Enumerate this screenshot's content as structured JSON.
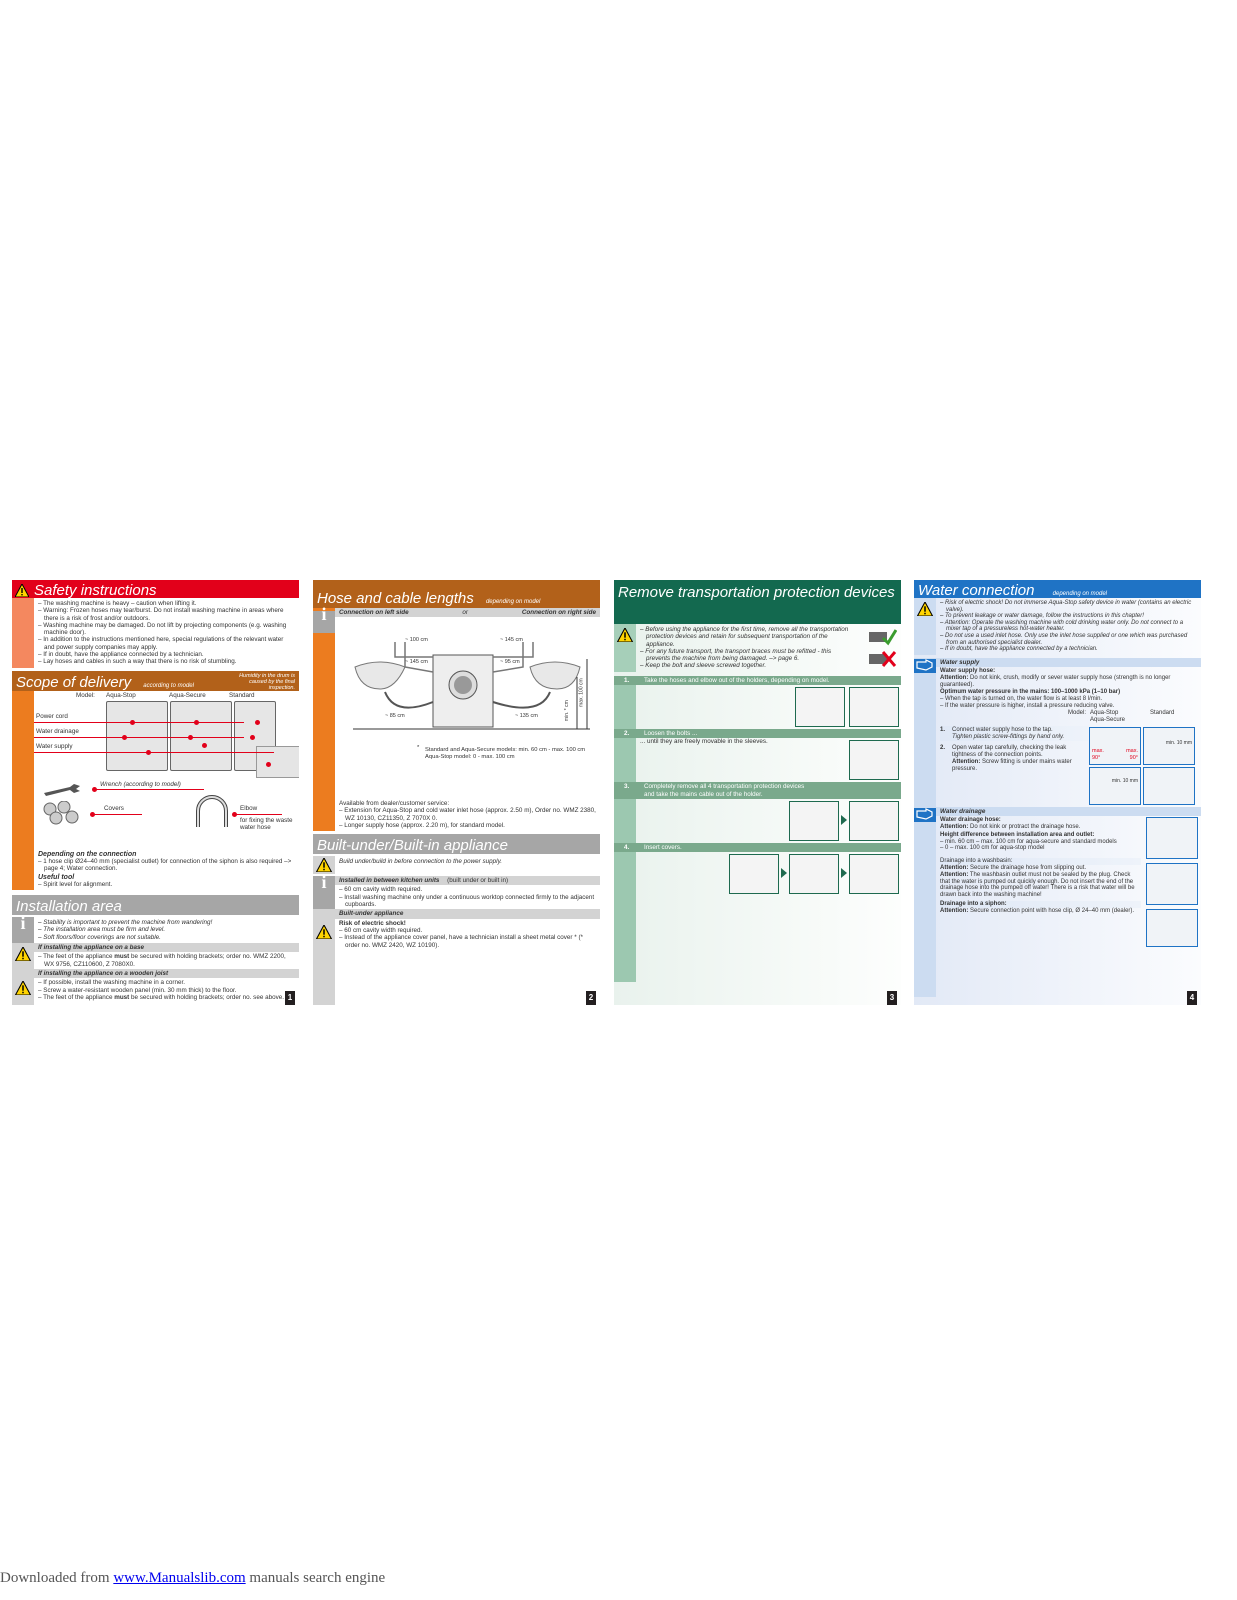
{
  "page1": {
    "safety": {
      "title": "Safety instructions",
      "items": [
        "The washing machine is heavy – caution when lifting it.",
        "Warning: Frozen hoses may tear/burst. Do not install washing machine in areas where there is a risk of frost and/or outdoors.",
        "Washing machine may be damaged. Do not lift by projecting components (e.g. washing machine door).",
        "In addition to the instructions mentioned here, special regulations of the relevant water and power supply companies may apply.",
        "If in doubt, have the appliance connected by a technician.",
        "Lay hoses and cables in such a way that there is no risk of stumbling."
      ]
    },
    "scope": {
      "title": "Scope of delivery",
      "subtitle": "according to model",
      "note": "Humidity in the drum is caused by the final inspection.",
      "model_label": "Model:",
      "models": [
        "Aqua-Stop",
        "Aqua-Secure",
        "Standard"
      ],
      "parts": [
        "Power cord",
        "Water drainage",
        "Water supply"
      ],
      "wrench": "Wrench (according to model)",
      "covers": "Covers",
      "elbow": "Elbow",
      "elbow_desc": "for fixing the waste water hose",
      "connection_heading": "Depending on the connection",
      "connection_text": "1 hose clip Ø24–40 mm (specialist outlet) for connection of the siphon is also required –> page 4; Water connection.",
      "tool_heading": "Useful tool",
      "tool_text": "Spirit level for alignment."
    },
    "installation": {
      "title": "Installation area",
      "info_items": [
        "Stability is important to prevent the machine from wandering!",
        "The installation area must be firm and level.",
        "Soft floors/floor coverings are not suitable."
      ],
      "base_heading": "If installing the appliance on a base",
      "base_text_pre": "The feet of the appliance ",
      "base_text_bold": "must",
      "base_text_post": " be secured with holding brackets; order no. WMZ 2200, WX 9756, CZ110600, Z 7080X0.",
      "joist_heading": "If installing the appliance on a wooden joist",
      "joist_items": [
        "If possible, install the washing machine in a corner.",
        "Screw a water-resistant wooden panel (min. 30 mm thick) to the floor."
      ],
      "joist_last_pre": "The feet of the appliance ",
      "joist_last_bold": "must",
      "joist_last_post": " be secured with holding brackets; order no. see above."
    },
    "page_number": "1"
  },
  "page2": {
    "hose": {
      "title": "Hose and cable lengths",
      "subtitle": "depending on model",
      "left_label": "Connection on left side",
      "or": "or",
      "right_label": "Connection on right side",
      "dims": {
        "l_top": "~ 100 cm",
        "l_mid": "~ 145 cm",
        "l_bot": "~ 85 cm",
        "r_top": "~ 145 cm",
        "r_mid": "~ 95 cm",
        "r_bot": "~ 135 cm",
        "min": "min. * cm",
        "max": "max. 100 cm"
      },
      "footnote_mark": "*",
      "footnote1": "Standard and Aqua-Secure models: min. 60 cm - max. 100 cm",
      "footnote2": "Aqua-Stop model: 0 - max. 100 cm",
      "dealer_heading": "Available from dealer/customer service:",
      "dealer_items": [
        "Extension for Aqua-Stop and cold water inlet hose (approx. 2.50 m), Order no. WMZ 2380, WZ 10130, CZ11350, Z 7070X 0.",
        "Longer supply hose (approx. 2.20 m), for standard model."
      ]
    },
    "builtin": {
      "title": "Built-under/Built-in appliance",
      "warning": "Build under/build in before connection to the power supply.",
      "kitchen_heading": "Installed in between kitchen units",
      "kitchen_sub": "(built under or built in)",
      "kitchen_items": [
        "60 cm cavity width required.",
        "Install washing machine only under a continuous worktop connected firmly to the adjacent cupboards."
      ],
      "under_heading": "Built-under appliance",
      "risk": "Risk of electric shock!",
      "under_items": [
        "60 cm cavity width required.",
        "Instead of the appliance cover panel, have a technician install a sheet metal cover * (* order no. WMZ 2420, WZ 10190)."
      ]
    },
    "page_number": "2"
  },
  "page3": {
    "title": "Remove transportation protection devices",
    "warning_items": [
      "Before using the appliance for the first time, remove all the transportation protection devices and retain for subsequent transportation of the appliance.",
      "For any future transport, the transport braces must be refitted - this prevents the machine from being damaged. –> page 6.",
      "Keep the bolt and sleeve screwed together."
    ],
    "steps": [
      {
        "num": "1.",
        "text": "Take the hoses and elbow out of the holders, depending on model.",
        "detail": ""
      },
      {
        "num": "2.",
        "text": "Loosen the bolts ...",
        "detail": "... until they are freely movable in the sleeves."
      },
      {
        "num": "3.",
        "text": "Completely remove all 4 transportation protection devices and take the mains cable out of the holder.",
        "detail": ""
      },
      {
        "num": "4.",
        "text": "Insert covers.",
        "detail": ""
      }
    ],
    "page_number": "3"
  },
  "page4": {
    "title": "Water connection",
    "subtitle": "depending on model",
    "warning_items": [
      "Risk of electric shock! Do not immerse Aqua-Stop safety device in water (contains an electric valve).",
      "To prevent leakage or water damage, follow the instructions in this chapter!",
      "Attention: Operate the washing machine with cold drinking water only. Do not connect to a mixer tap of a pressureless hot-water heater.",
      "Do not use a used inlet hose. Only use the inlet hose supplied or one which was purchased from an authorised specialist dealer.",
      "If in doubt, have the appliance connected by a technician."
    ],
    "supply": {
      "heading": "Water supply",
      "hose_heading": "Water supply hose:",
      "attention": "Attention:",
      "hose_text": "Do not kink, crush, modify or sever water supply hose (strength is no longer guaranteed).",
      "pressure_heading": "Optimum water pressure in the mains: 100–1000 kPa (1–10 bar)",
      "pressure_items": [
        "When the tap is turned on, the water flow is at least 8 l/min.",
        "If the water pressure is higher, install a pressure reducing valve."
      ],
      "model_label": "Model:",
      "model_a": "Aqua-Stop",
      "model_a2": "Aqua-Secure",
      "model_b": "Standard",
      "step1_num": "1.",
      "step1_text": "Connect water supply hose to the tap.",
      "step1_italic": "Tighten plastic screw-fittings by hand only.",
      "step2_num": "2.",
      "step2_text": "Open water tap carefully, checking the leak tightness of the connection points.",
      "step2_attention": "Attention:",
      "step2_att_text": "Screw fitting is under mains water pressure.",
      "max_label": "max.",
      "deg_label": "90°",
      "min_label": "min. 10 mm"
    },
    "drainage": {
      "heading": "Water drainage",
      "hose_heading": "Water drainage hose:",
      "attention": "Attention:",
      "hose_text": "Do not kink or protract the drainage hose.",
      "height_heading": "Height difference between installation area and outlet:",
      "height_items": [
        "min. 60 cm – max. 100 cm for aqua-secure and standard models",
        "0 – max. 100 cm for aqua-stop model"
      ],
      "washbasin_heading": "Drainage into a washbasin:",
      "washbasin_att1": "Secure the drainage hose from slipping out.",
      "washbasin_att2": "The washbasin outlet must not be sealed by the plug. Check that the water is pumped out quickly enough. Do not insert the end of the drainage hose into the pumped off water! There is a risk that water will be drawn back into the washing machine!",
      "siphon_heading": "Drainage into a siphon:",
      "siphon_att": "Secure connection point with hose clip, Ø 24–40 mm (dealer)."
    },
    "page_number": "4"
  },
  "footer": {
    "prefix": "Downloaded from ",
    "link": "www.Manualslib.com",
    "suffix": " manuals search engine"
  },
  "colors": {
    "safety_red": "#e2001a",
    "safety_light": "#f7a58a",
    "scope_brown": "#b2611a",
    "scope_orange": "#ec7c1f",
    "gray": "#a6a6a6",
    "light_gray": "#d3d3d3",
    "green_dark": "#13694f",
    "green_mid": "#7aa98c",
    "green_light": "#a6cfb9",
    "blue": "#1f73c5",
    "blue_light": "#ccdcf1"
  }
}
